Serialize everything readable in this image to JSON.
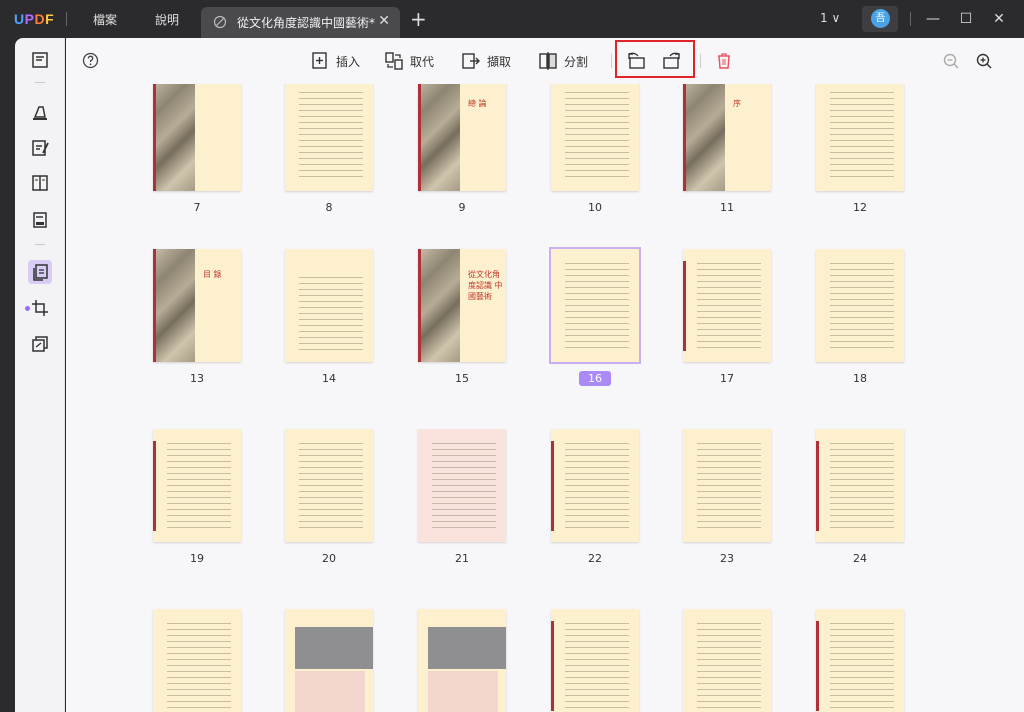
{
  "app": {
    "logo": "UPDF",
    "menus": [
      "檔案",
      "說明"
    ]
  },
  "tab": {
    "title": "從文化角度認識中國藝術*",
    "close": "✕",
    "add": "+"
  },
  "window": {
    "page_indicator": "1 ∨",
    "avatar_letter": "吾",
    "minimize": "—",
    "maximize": "☐",
    "close": "✕"
  },
  "toolbar": {
    "insert_label": "插入",
    "replace_label": "取代",
    "extract_label": "擷取",
    "split_label": "分割"
  },
  "accent_colors": {
    "brand": "#a98af7",
    "highlight": "#e0242c",
    "delete": "#e8505b"
  },
  "pages": [
    {
      "num": "7",
      "kind": "art"
    },
    {
      "num": "8",
      "kind": "text"
    },
    {
      "num": "9",
      "kind": "art-title",
      "title": "總 論"
    },
    {
      "num": "10",
      "kind": "text"
    },
    {
      "num": "11",
      "kind": "art-title",
      "title": "序"
    },
    {
      "num": "12",
      "kind": "text"
    },
    {
      "num": "13",
      "kind": "art-title",
      "title": "目 錄"
    },
    {
      "num": "14",
      "kind": "toc"
    },
    {
      "num": "15",
      "kind": "art-title",
      "title": "從文化角度認識 中國藝術"
    },
    {
      "num": "16",
      "kind": "text-selected"
    },
    {
      "num": "17",
      "kind": "text-bar"
    },
    {
      "num": "18",
      "kind": "text"
    },
    {
      "num": "19",
      "kind": "text-bar"
    },
    {
      "num": "20",
      "kind": "text"
    },
    {
      "num": "21",
      "kind": "text-pink"
    },
    {
      "num": "22",
      "kind": "text-bar"
    },
    {
      "num": "23",
      "kind": "text"
    },
    {
      "num": "24",
      "kind": "text-bar"
    },
    {
      "num": "",
      "kind": "text"
    },
    {
      "num": "",
      "kind": "gray-block"
    },
    {
      "num": "",
      "kind": "gray-block"
    },
    {
      "num": "",
      "kind": "text-bar"
    },
    {
      "num": "",
      "kind": "text"
    },
    {
      "num": "",
      "kind": "text-bar"
    }
  ],
  "selected_page": "16"
}
